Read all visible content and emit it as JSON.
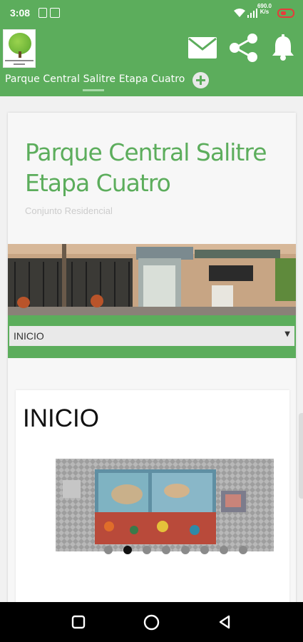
{
  "status_bar": {
    "time": "3:08",
    "speed_top": "690.0",
    "speed_bottom": "K/s"
  },
  "app_bar": {
    "site_tab_title": "Parque Central Salitre Etapa Cuatro",
    "icons": [
      "mail-icon",
      "share-icon",
      "bell-icon",
      "add-icon"
    ]
  },
  "page": {
    "site_title": "Parque Central Salitre Etapa Cuatro",
    "site_subtitle": "Conjunto Residencial",
    "menu_selected": "INICIO",
    "section_heading": "INICIO"
  },
  "carousel": {
    "dot_count": 8,
    "active_index": 1
  },
  "colors": {
    "brand_green": "#5cad5c",
    "nav_black": "#000000"
  }
}
